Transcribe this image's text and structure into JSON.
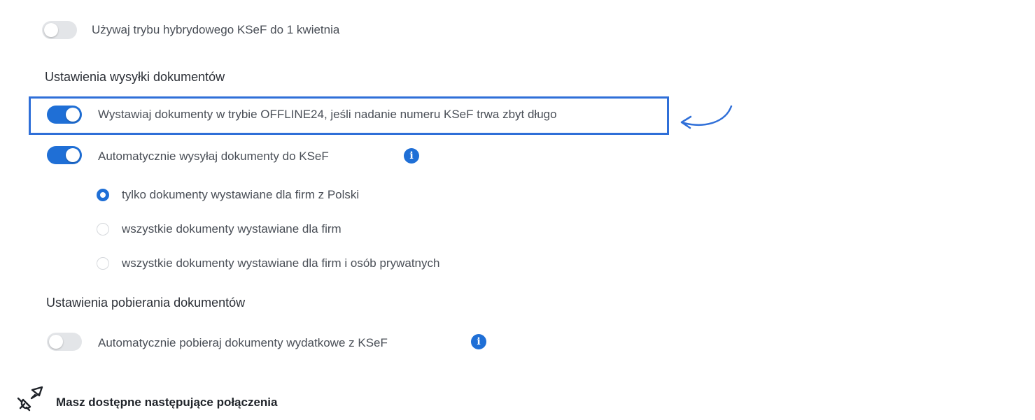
{
  "settings": {
    "hybrid_mode": {
      "label": "Używaj trybu hybrydowego KSeF do 1 kwietnia",
      "enabled": false
    },
    "sending_heading": "Ustawienia wysyłki dokumentów",
    "offline24": {
      "label": "Wystawiaj dokumenty w trybie OFFLINE24, jeśli nadanie numeru KSeF trwa zbyt długo",
      "enabled": true
    },
    "auto_send": {
      "label": "Automatycznie wysyłaj dokumenty do KSeF",
      "enabled": true,
      "info_icon": "info-icon"
    },
    "send_scope": {
      "options": [
        {
          "label": "tylko dokumenty wystawiane dla firm z Polski",
          "checked": true
        },
        {
          "label": "wszystkie dokumenty wystawiane dla firm",
          "checked": false
        },
        {
          "label": "wszystkie dokumenty wystawiane dla firm i osób prywatnych",
          "checked": false
        }
      ]
    },
    "download_heading": "Ustawienia pobierania dokumentów",
    "auto_download": {
      "label": "Automatycznie pobieraj dokumenty wydatkowe z KSeF",
      "enabled": false,
      "info_icon": "info-icon"
    }
  },
  "connections": {
    "icon": "plug-connection-icon",
    "title": "Masz dostępne następujące połączenia"
  },
  "annotation": {
    "highlight_color": "#2f6fd8",
    "arrow_icon": "curved-arrow-icon"
  },
  "colors": {
    "accent": "#1f6fd6",
    "toggle_off": "#e3e5e8",
    "text": "#4a4f57"
  }
}
